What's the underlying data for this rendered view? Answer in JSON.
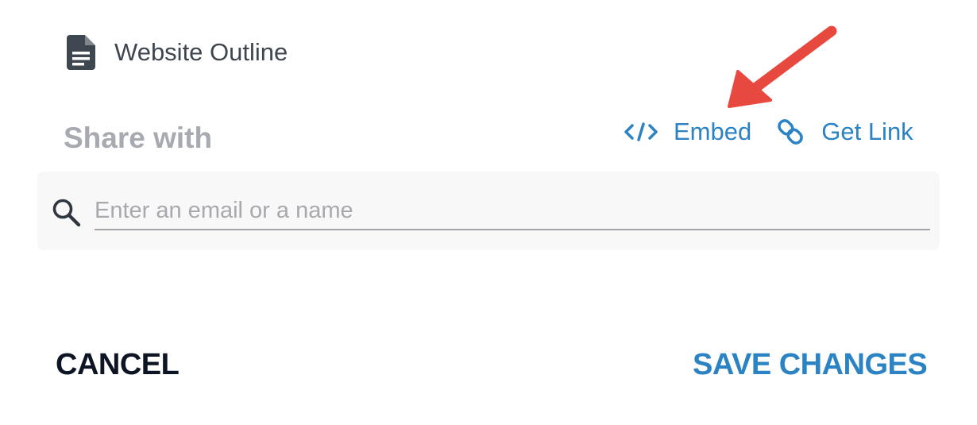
{
  "document": {
    "icon": "document-icon",
    "title": "Website Outline"
  },
  "share": {
    "label": "Share with",
    "actions": {
      "embed": {
        "icon": "code-icon",
        "label": "Embed"
      },
      "get_link": {
        "icon": "link-icon",
        "label": "Get Link"
      }
    },
    "search": {
      "icon": "search-icon",
      "placeholder": "Enter an email or a name",
      "value": ""
    }
  },
  "buttons": {
    "cancel_label": "CANCEL",
    "save_label": "SAVE CHANGES"
  },
  "annotation": {
    "type": "arrow",
    "color": "#e8493f",
    "points_to": "embed"
  },
  "colors": {
    "accent": "#2b83c3",
    "title_text": "#3e4650",
    "muted_label": "#a7aab0",
    "cancel_text": "#0d1423",
    "search_bg": "#f8f8f8"
  }
}
